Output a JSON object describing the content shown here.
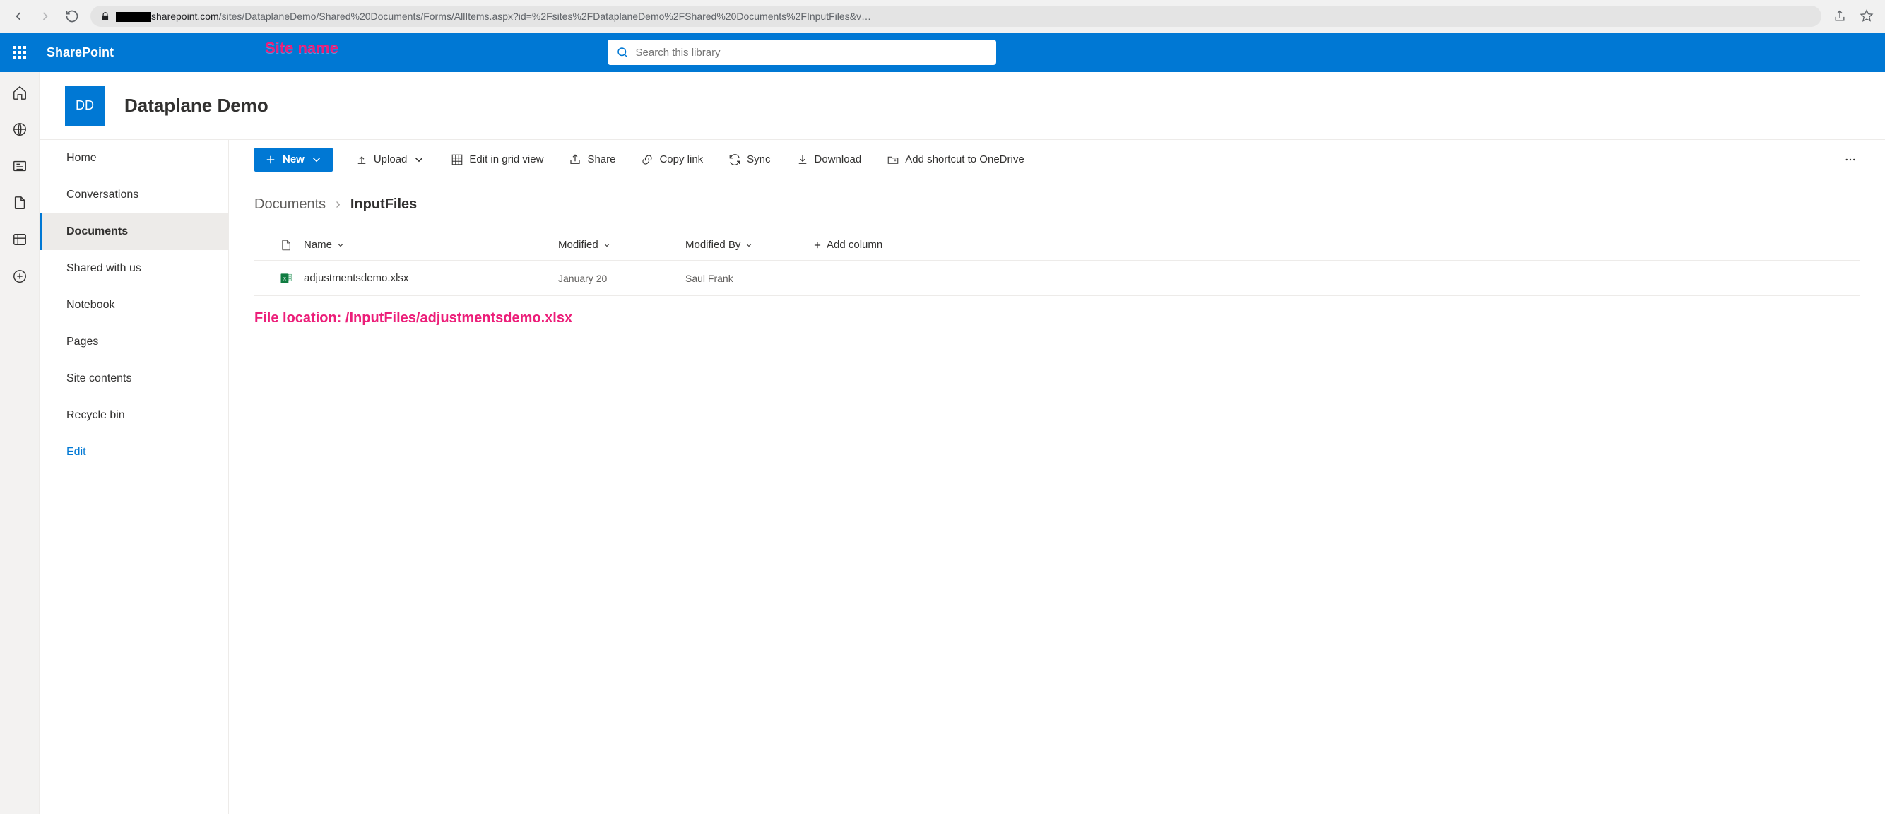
{
  "browser": {
    "url_host_visible": "sharepoint.com",
    "url_path": "/sites/DataplaneDemo/Shared%20Documents/Forms/AllItems.aspx?id=%2Fsites%2FDataplaneDemo%2FShared%20Documents%2FInputFiles&v…",
    "url_highlight_segment": "DataplaneDemo"
  },
  "suite": {
    "product": "SharePoint",
    "search_placeholder": "Search this library"
  },
  "annotation": {
    "site_name_label": "Site name",
    "file_location": "File location: /InputFiles/adjustmentsdemo.xlsx"
  },
  "site": {
    "initials": "DD",
    "title": "Dataplane Demo"
  },
  "left_nav": {
    "home": "Home",
    "conversations": "Conversations",
    "documents": "Documents",
    "shared": "Shared with us",
    "notebook": "Notebook",
    "pages": "Pages",
    "site_contents": "Site contents",
    "recycle": "Recycle bin",
    "edit": "Edit"
  },
  "commands": {
    "new": "New",
    "upload": "Upload",
    "edit_grid": "Edit in grid view",
    "share": "Share",
    "copy_link": "Copy link",
    "sync": "Sync",
    "download": "Download",
    "shortcut": "Add shortcut to OneDrive"
  },
  "breadcrumb": {
    "root": "Documents",
    "current": "InputFiles"
  },
  "table": {
    "col_name": "Name",
    "col_modified": "Modified",
    "col_modified_by": "Modified By",
    "col_add": "Add column",
    "rows": [
      {
        "name": "adjustmentsdemo.xlsx",
        "modified": "January 20",
        "modified_by": "Saul Frank"
      }
    ]
  }
}
